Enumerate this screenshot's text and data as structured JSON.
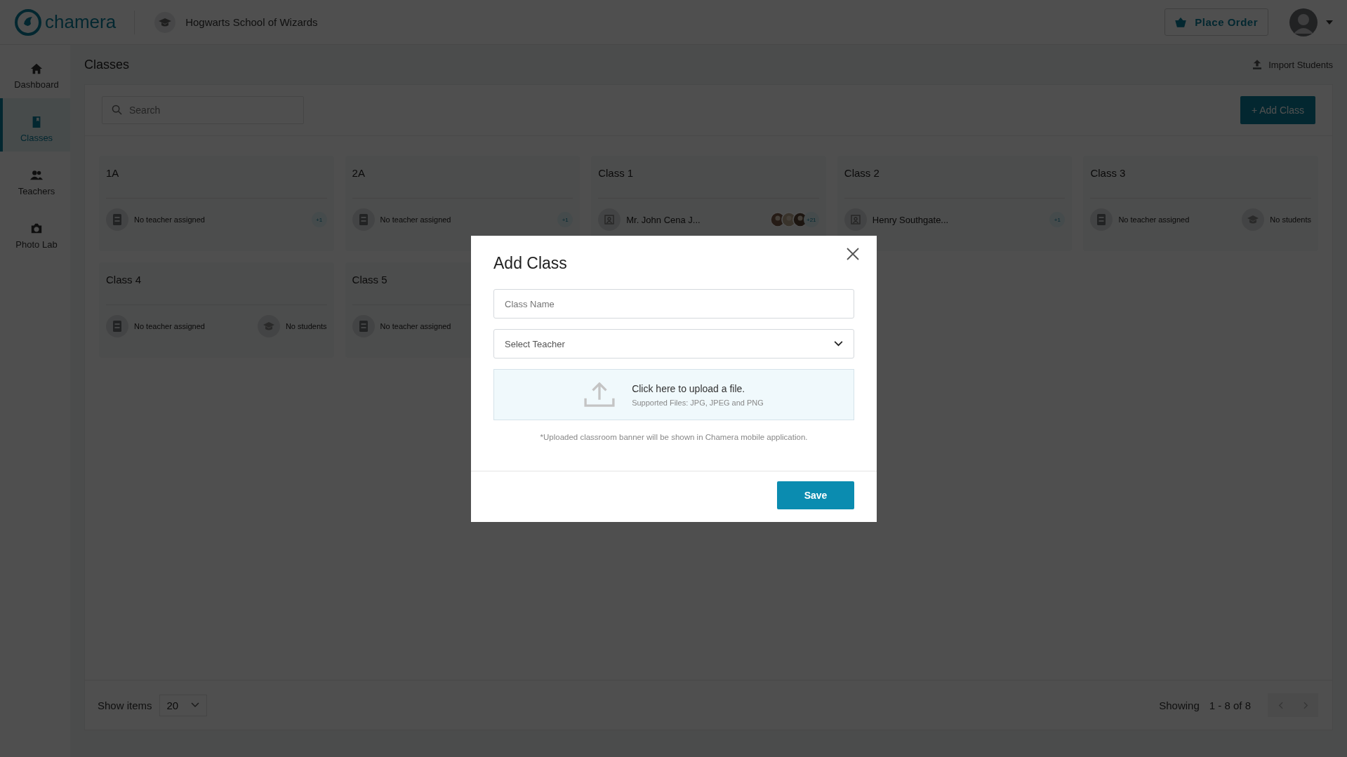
{
  "brand": "chamera",
  "school": "Hogwarts School of Wizards",
  "header_button": "Place Order",
  "sidebar": [
    {
      "label": "Dashboard",
      "kind": "home",
      "selected": false
    },
    {
      "label": "Classes",
      "kind": "book",
      "selected": true
    },
    {
      "label": "Teachers",
      "kind": "people",
      "selected": false
    },
    {
      "label": "Photo Lab",
      "kind": "camera",
      "selected": false
    }
  ],
  "page_title": "Classes",
  "import_link": "Import Students",
  "search": {
    "placeholder": "Search"
  },
  "add_button": "+ Add Class",
  "classes": [
    {
      "title": "1A",
      "teacher": {
        "name": "No teacher assigned",
        "assigned": false
      },
      "students": {
        "kind": "count",
        "text": "+1"
      }
    },
    {
      "title": "2A",
      "teacher": {
        "name": "No teacher assigned",
        "assigned": false
      },
      "students": {
        "kind": "count",
        "text": "+1"
      }
    },
    {
      "title": "Class 1",
      "teacher": {
        "name": "Mr. John Cena J...",
        "assigned": true
      },
      "students": {
        "kind": "avatars",
        "text": "+21"
      }
    },
    {
      "title": "Class 2",
      "teacher": {
        "name": "Henry Southgate...",
        "assigned": true
      },
      "students": {
        "kind": "count",
        "text": "+1"
      }
    },
    {
      "title": "Class 3",
      "teacher": {
        "name": "No teacher assigned",
        "assigned": false
      },
      "students": {
        "kind": "none",
        "text": "No students"
      }
    },
    {
      "title": "Class 4",
      "teacher": {
        "name": "No teacher assigned",
        "assigned": false
      },
      "students": {
        "kind": "none",
        "text": "No students"
      }
    },
    {
      "title": "Class 5",
      "teacher": {
        "name": "No teacher assigned",
        "assigned": false
      }
    }
  ],
  "footer": {
    "show_label": "Show items",
    "page_size": "20",
    "showing_label": "Showing",
    "range": "1 - 8 of 8"
  },
  "modal": {
    "title": "Add Class",
    "class_name": {
      "placeholder": "Class Name"
    },
    "teacher_select": {
      "placeholder": "Select Teacher"
    },
    "upload": {
      "title": "Click here to upload a file.",
      "hint": "Supported Files: JPG, JPEG and PNG"
    },
    "note": "*Uploaded classroom banner will be shown in Chamera mobile application.",
    "save": "Save"
  }
}
